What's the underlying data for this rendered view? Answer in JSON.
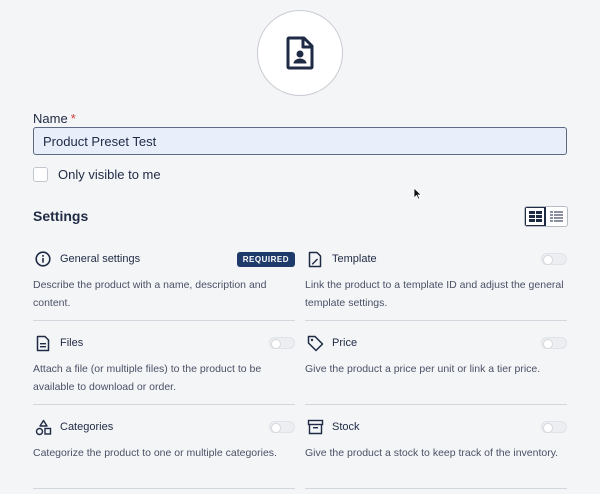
{
  "form": {
    "name_label": "Name",
    "required_mark": "*",
    "name_value": "Product Preset Test",
    "visible_label": "Only visible to me",
    "visible_checked": false
  },
  "settings": {
    "title": "Settings",
    "view_modes": [
      "grid-view-icon",
      "list-view-icon"
    ],
    "cards": [
      {
        "id": "general",
        "icon": "info-icon",
        "title": "General settings",
        "badge": "REQUIRED",
        "enabled": true,
        "desc": "Describe the product with a name, description and content."
      },
      {
        "id": "template",
        "icon": "template-icon",
        "title": "Template",
        "enabled": false,
        "desc": "Link the product to a template ID and adjust the general template settings."
      },
      {
        "id": "files",
        "icon": "file-icon",
        "title": "Files",
        "enabled": false,
        "desc": "Attach a file (or multiple files) to the product to be available to download or order."
      },
      {
        "id": "price",
        "icon": "tag-icon",
        "title": "Price",
        "enabled": false,
        "desc": "Give the product a price per unit or link a tier price."
      },
      {
        "id": "categories",
        "icon": "categories-icon",
        "title": "Categories",
        "enabled": false,
        "desc": "Categorize the product to one or multiple categories."
      },
      {
        "id": "stock",
        "icon": "box-icon",
        "title": "Stock",
        "enabled": false,
        "desc": "Give the product a stock to keep track of the inventory."
      }
    ]
  },
  "colors": {
    "accent": "#1e3a6a",
    "text": "#1f2a44",
    "input_bg": "#e8effb",
    "required": "#d23b3b"
  }
}
